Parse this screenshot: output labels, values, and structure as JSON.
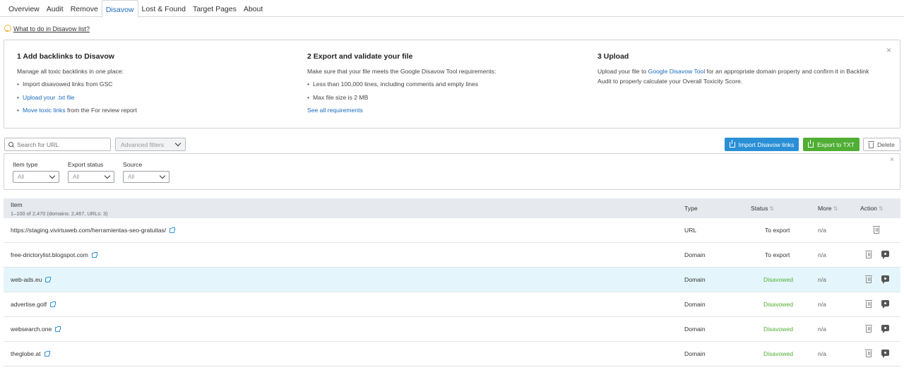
{
  "tabs": [
    {
      "label": "Overview"
    },
    {
      "label": "Audit"
    },
    {
      "label": "Remove"
    },
    {
      "label": "Disavow",
      "active": true
    },
    {
      "label": "Lost & Found"
    },
    {
      "label": "Target Pages"
    },
    {
      "label": "About"
    }
  ],
  "help_link": "What to do in Disavow list?",
  "steps": {
    "s1": {
      "title": "1  Add backlinks to Disavow",
      "desc": "Manage all toxic backlinks in one place:",
      "items": [
        "Import disavowed links from GSC",
        "Upload your .txt file",
        "Move toxic links",
        " from the For review report"
      ]
    },
    "s2": {
      "title": "2  Export and validate your file",
      "desc": "Make sure that your file meets the Google Disavow Tool requirements:",
      "items": [
        "Less than 100,000 lines, including comments and empty lines",
        "Max file size is 2 MB"
      ],
      "link": "See all requirements"
    },
    "s3": {
      "title": "3  Upload",
      "desc_a": "Upload your file to ",
      "desc_link": "Google Disavow Tool",
      "desc_b": " for an appropriate domain property and confirm it in Backlink Audit to properly calculate your Overall Toxicity Score."
    }
  },
  "toolbar": {
    "search_placeholder": "Search for URL",
    "advanced_filters": "Advanced filters",
    "import_label": "Import Disavow links",
    "export_label": "Export to TXT",
    "delete_label": "Delete"
  },
  "filters": {
    "item_type": {
      "label": "Item type",
      "value": "All"
    },
    "export_status": {
      "label": "Export status",
      "value": "All"
    },
    "source": {
      "label": "Source",
      "value": "All"
    }
  },
  "table": {
    "headers": {
      "item": "Item",
      "item_sub": "1–100 of 2,470 (domains: 2,467, URLs: 3)",
      "type": "Type",
      "status": "Status",
      "more": "More",
      "action": "Action"
    },
    "rows": [
      {
        "item": "https://staging.vivirtuweb.com/herramientas-seo-gratuitas/",
        "type": "URL",
        "status": "To export",
        "more": "n/a"
      },
      {
        "item": "free-drictorylist.blogspot.com",
        "type": "Domain",
        "status": "To export",
        "more": "n/a"
      },
      {
        "item": "web-ads.eu",
        "type": "Domain",
        "status": "Disavowed",
        "more": "n/a"
      },
      {
        "item": "advertise.golf",
        "type": "Domain",
        "status": "Disavowed",
        "more": "n/a"
      },
      {
        "item": "websearch.one",
        "type": "Domain",
        "status": "Disavowed",
        "more": "n/a"
      },
      {
        "item": "theglobe.at",
        "type": "Domain",
        "status": "Disavowed",
        "more": "n/a"
      }
    ]
  },
  "colors": {
    "accent": "#1a6bbf",
    "import_btn": "#2a8fd6",
    "export_btn": "#4fae33",
    "disavowed": "#4fae33",
    "highlight_row": "#e4f6fb"
  }
}
